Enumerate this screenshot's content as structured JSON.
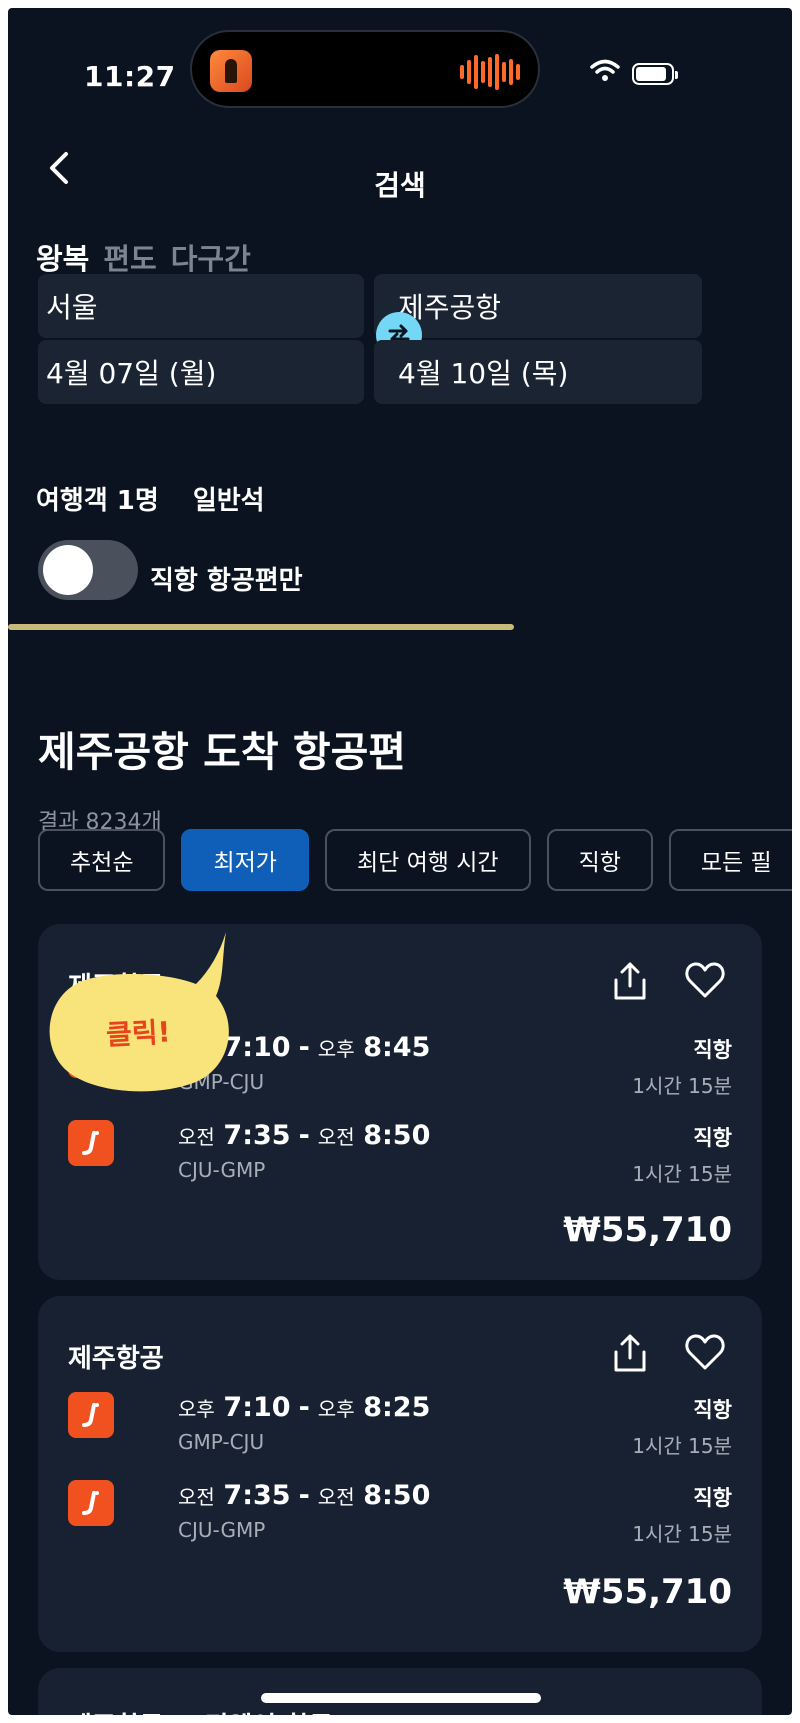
{
  "status_bar": {
    "time": "11:27"
  },
  "header": {
    "title": "검색"
  },
  "trip_tabs": [
    {
      "label": "왕복",
      "active": true
    },
    {
      "label": "편도",
      "active": false
    },
    {
      "label": "다구간",
      "active": false
    }
  ],
  "search": {
    "origin": "서울",
    "destination": "제주공항",
    "depart_date": "4월 07일 (월)",
    "return_date": "4월 10일 (목)",
    "travelers": "여행객 1명",
    "cabin": "일반석",
    "direct_only_label": "직항 항공편만",
    "direct_only": false
  },
  "results": {
    "title": "제주공항 도착 항공편",
    "count_text": "결과 8234개",
    "sort_chips": [
      {
        "label": "추천순",
        "active": false
      },
      {
        "label": "최저가",
        "active": true
      },
      {
        "label": "최단 여행 시간",
        "active": false
      },
      {
        "label": "직항",
        "active": false
      },
      {
        "label": "모든 필",
        "active": false
      }
    ],
    "cards": [
      {
        "airline": "제주항공",
        "legs": [
          {
            "dep_ampm": "오후",
            "dep_time": "7:10",
            "arr_ampm": "오후",
            "arr_time": "8:45",
            "route": "GMP-CJU",
            "type": "직항",
            "duration": "1시간 15분"
          },
          {
            "dep_ampm": "오전",
            "dep_time": "7:35",
            "arr_ampm": "오전",
            "arr_time": "8:50",
            "route": "CJU-GMP",
            "type": "직항",
            "duration": "1시간 15분"
          }
        ],
        "price": "₩55,710"
      },
      {
        "airline": "제주항공",
        "legs": [
          {
            "dep_ampm": "오후",
            "dep_time": "7:10",
            "arr_ampm": "오후",
            "arr_time": "8:25",
            "route": "GMP-CJU",
            "type": "직항",
            "duration": "1시간 15분"
          },
          {
            "dep_ampm": "오전",
            "dep_time": "7:35",
            "arr_ampm": "오전",
            "arr_time": "8:50",
            "route": "CJU-GMP",
            "type": "직항",
            "duration": "1시간 15분"
          }
        ],
        "price": "₩55,710"
      },
      {
        "airline": "제주항공 & 티웨이 항공"
      }
    ]
  },
  "annotation": {
    "text": "클릭!"
  },
  "colors": {
    "background": "#0b1220",
    "card": "#182131",
    "field": "#1b2433",
    "accent_blue": "#0f5fb8",
    "swap_button": "#74d7f5",
    "airline_logo": "#f0511f",
    "annotation_bubble": "#f8e47a",
    "annotation_text": "#e8431d"
  },
  "icons": [
    "back-chevron",
    "swap-arrows",
    "share",
    "heart",
    "wifi",
    "battery",
    "airline-logo"
  ]
}
